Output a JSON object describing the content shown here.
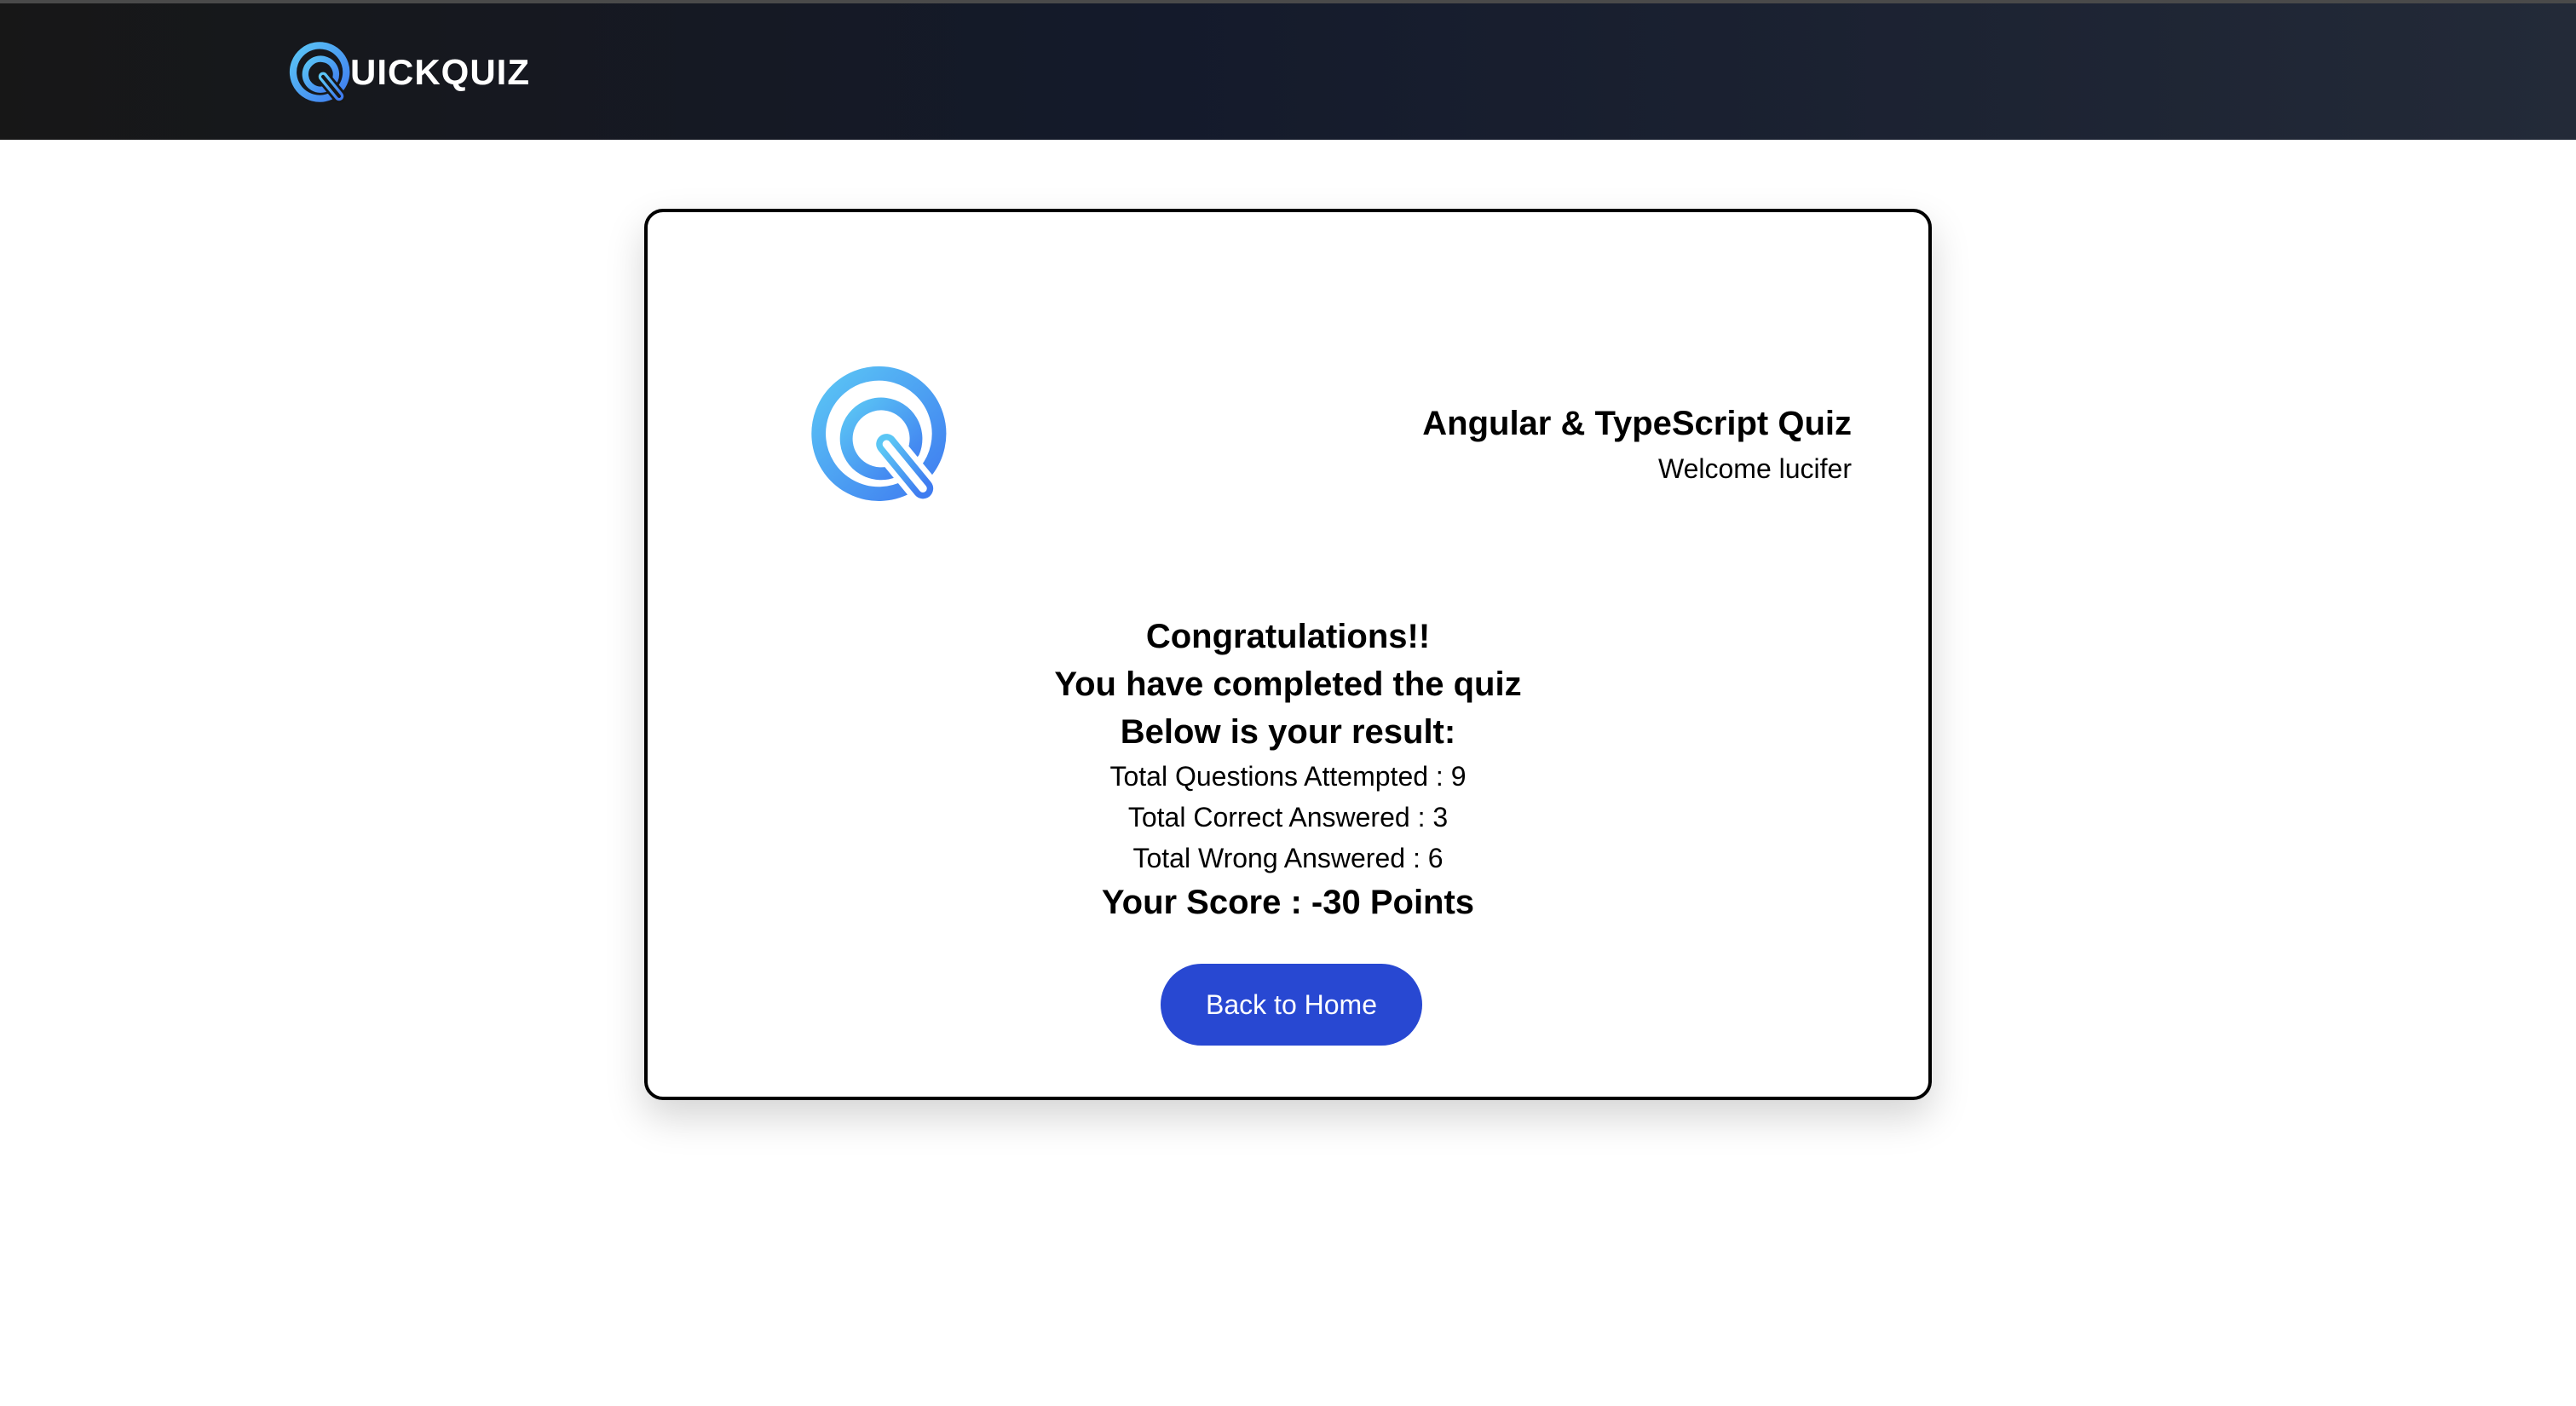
{
  "brand": {
    "logo_icon": "quickquiz-logo-icon",
    "name": "UICKQUIZ"
  },
  "quiz": {
    "title": "Angular & TypeScript Quiz",
    "welcome": "Welcome lucifer",
    "logo_icon": "quickquiz-logo-icon"
  },
  "result": {
    "congratulations": "Congratulations!!",
    "completed": "You have completed the quiz",
    "below_result": "Below is your result:",
    "attempted": "Total Questions Attempted : 9",
    "correct": "Total Correct Answered : 3",
    "wrong": "Total Wrong Answered : 6",
    "score": "Your Score : -30 Points"
  },
  "actions": {
    "back_to_home": "Back to Home"
  },
  "colors": {
    "accent": "#2848D2",
    "logo_light": "#5BC6F5",
    "logo_dark": "#3F7CF0",
    "header_dark": "#171717"
  }
}
